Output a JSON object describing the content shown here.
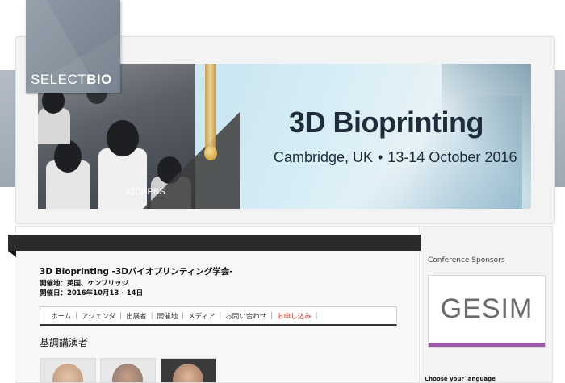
{
  "logo": {
    "text_light": "SELECT",
    "text_bold": "BIO"
  },
  "banner": {
    "title": "3D Bioprinting",
    "location": "Cambridge, UK",
    "separator": "•",
    "dates": "13-14 October 2016",
    "hashtag": "#3DBPBS"
  },
  "event": {
    "title": "3D Bioprinting -3Dバイオプリンティング学会-",
    "venue": "開催地：英国、ケンブリッジ",
    "date": "開催日：2016年10月13 - 14日"
  },
  "nav": {
    "items": [
      {
        "label": "ホーム"
      },
      {
        "label": "アジェンダ"
      },
      {
        "label": "出展者"
      },
      {
        "label": "開催地"
      },
      {
        "label": "メディア"
      },
      {
        "label": "お問い合わせ"
      },
      {
        "label": "お申し込み"
      }
    ],
    "separator": "|"
  },
  "keynote": {
    "heading": "基調講演者"
  },
  "sidebar": {
    "sponsors_title": "Conference Sponsors",
    "sponsor_name": "GESIM",
    "language_label": "Choose your language"
  },
  "colors": {
    "dark_bar": "#2b2b2b",
    "highlight_nav": "#c0392b",
    "sponsor_accent": "#9b5aa6"
  }
}
